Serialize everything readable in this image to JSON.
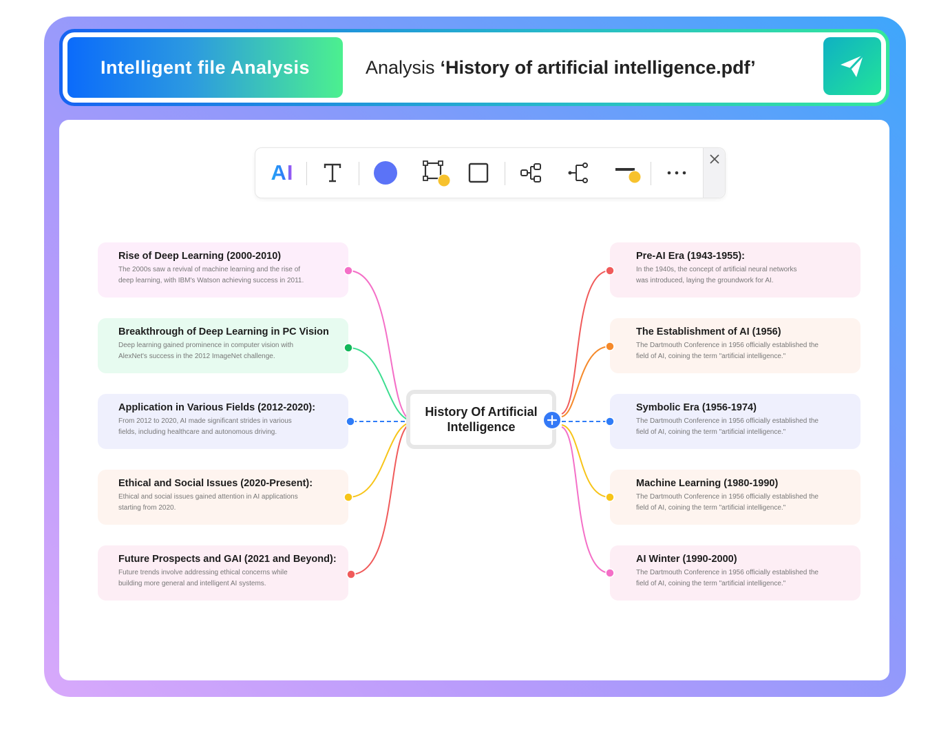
{
  "header": {
    "badge": "Intelligent file Analysis",
    "query_prefix": "Analysis",
    "query_file": "‘History of artificial intelligence.pdf’",
    "send_icon": "paper-plane-icon"
  },
  "toolbar": {
    "ai_label": "AI",
    "items": [
      "ai-icon",
      "text-icon",
      "fill-color-icon",
      "border-style-icon",
      "shape-icon",
      "branch-icon",
      "subtopic-icon",
      "line-style-icon",
      "more-icon",
      "close-icon"
    ],
    "fill_color": "#5b73f7",
    "accent_dot": "#f7c22e"
  },
  "mindmap": {
    "center": {
      "line1": "History Of Artificial",
      "line2": "Intelligence"
    },
    "left": [
      {
        "title": "Rise of Deep Learning (2000-2010)",
        "desc1": "The 2000s saw a revival of machine learning and the rise of",
        "desc2": "deep learning, with IBM's Watson achieving success in 2011.",
        "bg": "#fdeefb",
        "color": "#f46fc7"
      },
      {
        "title": "Breakthrough of Deep Learning in PC Vision",
        "desc1": "Deep learning gained prominence in computer vision with",
        "desc2": "AlexNet's success in the 2012 ImageNet challenge.",
        "bg": "#e7fbf0",
        "color": "#13b75a"
      },
      {
        "title": "Application in Various Fields (2012-2020):",
        "desc1": "From 2012 to 2020, AI made significant strides in various",
        "desc2": "fields, including healthcare and autonomous driving.",
        "bg": "#eff0fd",
        "color": "#2f7cf7"
      },
      {
        "title": "Ethical and Social Issues  (2020-Present):",
        "desc1": "Ethical and social issues gained attention in AI applications",
        "desc2": "starting from 2020.",
        "bg": "#fef4ef",
        "color": "#f7c418"
      },
      {
        "title": "Future Prospects and GAI (2021 and Beyond):",
        "desc1": "Future trends involve addressing ethical concerns while",
        "desc2": "building more general and intelligent AI systems.",
        "bg": "#fdeef5",
        "color": "#f05a5a"
      }
    ],
    "right": [
      {
        "title": "Pre-AI Era (1943-1955):",
        "desc1": "In the 1940s, the concept of artificial neural networks",
        "desc2": "was introduced, laying the groundwork for AI.",
        "bg": "#fdeef5",
        "color": "#f05a5a"
      },
      {
        "title": "The Establishment of AI (1956)",
        "desc1": "The Dartmouth Conference in 1956 officially established the",
        "desc2": "field of AI, coining the term \"artificial intelligence.\"",
        "bg": "#fef4ef",
        "color": "#f5892a"
      },
      {
        "title": "Symbolic Era (1956-1974)",
        "desc1": "The Dartmouth Conference in 1956 officially established the",
        "desc2": "field of AI, coining the term \"artificial intelligence.\"",
        "bg": "#eff0fd",
        "color": "#2f7cf7"
      },
      {
        "title": "Machine Learning (1980-1990)",
        "desc1": "The Dartmouth Conference in 1956 officially established the",
        "desc2": "field of AI, coining the term \"artificial intelligence.\"",
        "bg": "#fef4ef",
        "color": "#f7c418"
      },
      {
        "title": "AI Winter (1990-2000)",
        "desc1": "The Dartmouth Conference in 1956 officially established the",
        "desc2": "field of AI, coining the term \"artificial intelligence.\"",
        "bg": "#fdeef5",
        "color": "#f46fc7"
      }
    ]
  }
}
